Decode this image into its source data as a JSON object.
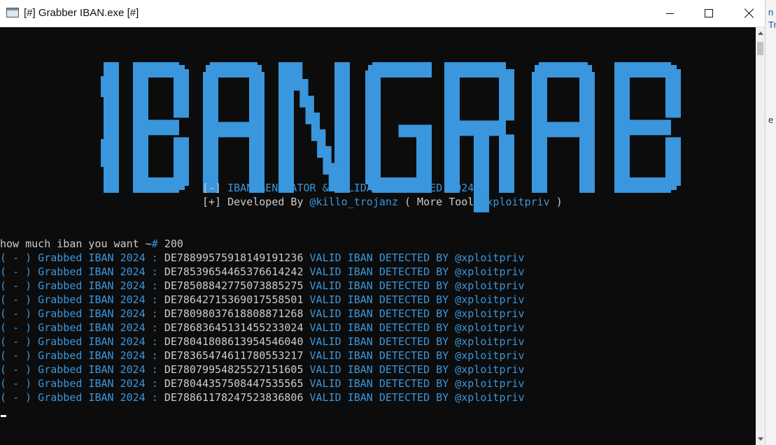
{
  "window": {
    "title": "[#] Grabber IBAN.exe [#]",
    "icon": "console-app-icon"
  },
  "colors": {
    "console_bg": "#0c0c0c",
    "accent_blue": "#3a96dd",
    "text_grey": "#cccccc"
  },
  "banner": {
    "logo_text": "IBANGRAB",
    "line1_prefix": "[-]",
    "line1_text": "IBAN GENERATOR & VALIDATOR UPDATED 2024",
    "line2_prefix": "[+]",
    "line2_text": "Developed By",
    "line2_author": "@killo_trojanz",
    "line2_paren_open": "( More Tool",
    "line2_more": "@xploitpriv",
    "line2_paren_close": ")"
  },
  "prompt": {
    "question": "how much iban you want ~",
    "hash": "#",
    "answer": "200"
  },
  "results": [
    {
      "prefix": "( - ) Grabbed IBAN 2024 :",
      "iban": "DE78899575918149191236",
      "status": "VALID IBAN DETECTED BY",
      "by": "@xploitpriv"
    },
    {
      "prefix": "( - ) Grabbed IBAN 2024 :",
      "iban": "DE78539654465376614242",
      "status": "VALID IBAN DETECTED BY",
      "by": "@xploitpriv"
    },
    {
      "prefix": "( - ) Grabbed IBAN 2024 :",
      "iban": "DE78508842775073885275",
      "status": "VALID IBAN DETECTED BY",
      "by": "@xploitpriv"
    },
    {
      "prefix": "( - ) Grabbed IBAN 2024 :",
      "iban": "DE78642715369017558501",
      "status": "VALID IBAN DETECTED BY",
      "by": "@xploitpriv"
    },
    {
      "prefix": "( - ) Grabbed IBAN 2024 :",
      "iban": "DE78098037618808871268",
      "status": "VALID IBAN DETECTED BY",
      "by": "@xploitpriv"
    },
    {
      "prefix": "( - ) Grabbed IBAN 2024 :",
      "iban": "DE78683645131455233024",
      "status": "VALID IBAN DETECTED BY",
      "by": "@xploitpriv"
    },
    {
      "prefix": "( - ) Grabbed IBAN 2024 :",
      "iban": "DE78041808613954546040",
      "status": "VALID IBAN DETECTED BY",
      "by": "@xploitpriv"
    },
    {
      "prefix": "( - ) Grabbed IBAN 2024 :",
      "iban": "DE78365474611780553217",
      "status": "VALID IBAN DETECTED BY",
      "by": "@xploitpriv"
    },
    {
      "prefix": "( - ) Grabbed IBAN 2024 :",
      "iban": "DE78079954825527151605",
      "status": "VALID IBAN DETECTED BY",
      "by": "@xploitpriv"
    },
    {
      "prefix": "( - ) Grabbed IBAN 2024 :",
      "iban": "DE78044357508447535565",
      "status": "VALID IBAN DETECTED BY",
      "by": "@xploitpriv"
    },
    {
      "prefix": "( - ) Grabbed IBAN 2024 :",
      "iban": "DE78861178247523836806",
      "status": "VALID IBAN DETECTED BY",
      "by": "@xploitpriv"
    }
  ],
  "background_window": {
    "fragments": [
      "n",
      "Tr",
      "e"
    ]
  }
}
